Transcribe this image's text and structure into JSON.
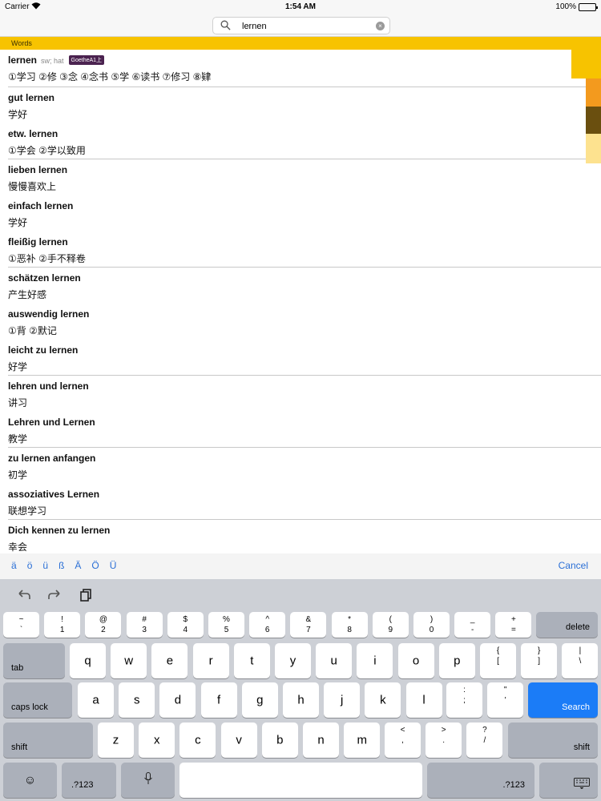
{
  "status": {
    "carrier": "Carrier",
    "time": "1:54 AM",
    "battery": "100%"
  },
  "search": {
    "value": "lernen"
  },
  "section": {
    "title": "Words"
  },
  "results": [
    {
      "word": "lernen",
      "gram": "sw; hat",
      "tag": "GoetheA1上",
      "meaning": "①学习 ②修 ③念 ④念书 ⑤学 ⑥读书 ⑦修习 ⑧肄"
    },
    {
      "word": "gut lernen",
      "meaning": "学好"
    },
    {
      "word": "etw. lernen",
      "meaning": "①学会 ②学以致用"
    },
    {
      "word": "lieben lernen",
      "meaning": "慢慢喜欢上"
    },
    {
      "word": "einfach lernen",
      "meaning": "学好"
    },
    {
      "word": "fleißig lernen",
      "meaning": "①恶补 ②手不释卷"
    },
    {
      "word": "schätzen lernen",
      "meaning": "产生好感"
    },
    {
      "word": "auswendig lernen",
      "meaning": "①背 ②默记"
    },
    {
      "word": "leicht zu lernen",
      "meaning": "好学"
    },
    {
      "word": "lehren und lernen",
      "meaning": "讲习"
    },
    {
      "word": "Lehren und Lernen",
      "meaning": "教学"
    },
    {
      "word": "zu lernen anfangen",
      "meaning": "初学"
    },
    {
      "word": "assoziatives Lernen",
      "meaning": "联想学习"
    },
    {
      "word": "Dich kennen zu lernen",
      "meaning": "幸会"
    }
  ],
  "accessory": {
    "umlauts": [
      "ä",
      "ö",
      "ü",
      "ß",
      "Ä",
      "Ö",
      "Ü"
    ],
    "cancel": "Cancel"
  },
  "keyboard": {
    "row1": [
      [
        "~",
        "`"
      ],
      [
        "!",
        "1"
      ],
      [
        "@",
        "2"
      ],
      [
        "#",
        "3"
      ],
      [
        "$",
        "4"
      ],
      [
        "%",
        "5"
      ],
      [
        "^",
        "6"
      ],
      [
        "&",
        "7"
      ],
      [
        "*",
        "8"
      ],
      [
        "(",
        "9"
      ],
      [
        ")",
        "0"
      ],
      [
        "_",
        "-"
      ],
      [
        "+",
        "="
      ]
    ],
    "delete": "delete",
    "tab": "tab",
    "row2": [
      "q",
      "w",
      "e",
      "r",
      "t",
      "y",
      "u",
      "i",
      "o",
      "p"
    ],
    "row2_sym": [
      [
        "{",
        "["
      ],
      [
        "}",
        "]"
      ],
      [
        "|",
        "\\"
      ]
    ],
    "caps": "caps lock",
    "row3": [
      "a",
      "s",
      "d",
      "f",
      "g",
      "h",
      "j",
      "k",
      "l"
    ],
    "row3_sym": [
      [
        ":",
        ";"
      ],
      [
        "\"",
        "'"
      ]
    ],
    "search": "Search",
    "shift": "shift",
    "row4": [
      "z",
      "x",
      "c",
      "v",
      "b",
      "n",
      "m"
    ],
    "row4_sym": [
      [
        "<",
        ","
      ],
      [
        ">",
        "."
      ],
      [
        "?",
        "/"
      ]
    ],
    "numbers": ".?123"
  }
}
